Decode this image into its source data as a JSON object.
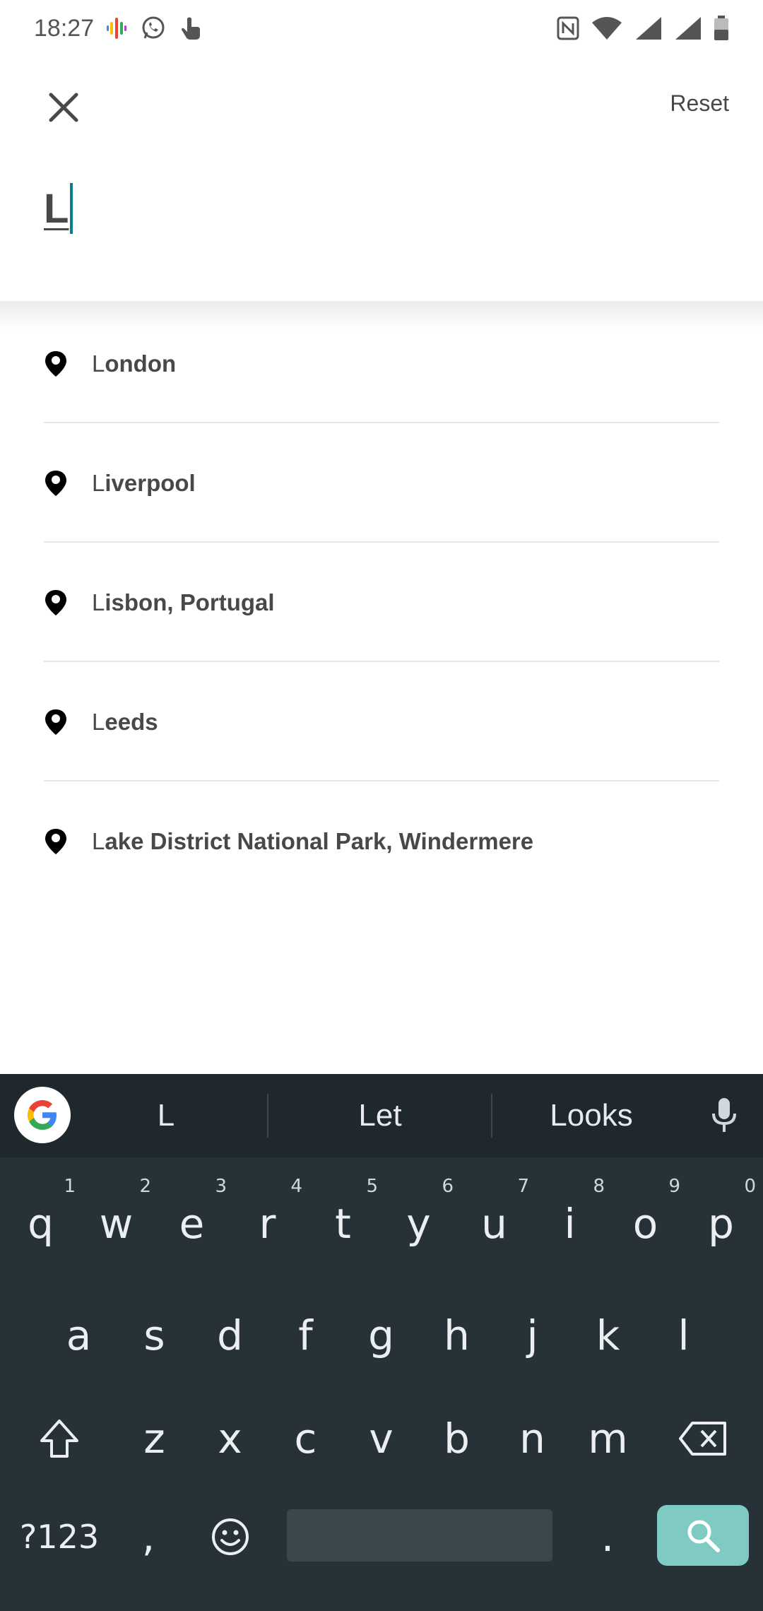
{
  "status_bar": {
    "time": "18:27",
    "left_icons": [
      "podcast-icon",
      "whatsapp-icon",
      "touch-icon"
    ],
    "right_icons": [
      "nfc-icon",
      "wifi-icon",
      "signal-icon",
      "signal-icon",
      "battery-icon"
    ]
  },
  "header": {
    "close_icon": "close-icon",
    "reset_label": "Reset"
  },
  "search": {
    "value": "L"
  },
  "suggestions": [
    {
      "first": "L",
      "rest": "ondon"
    },
    {
      "first": "L",
      "rest": "iverpool"
    },
    {
      "first": "L",
      "rest": "isbon, Portugal"
    },
    {
      "first": "L",
      "rest": "eeds"
    },
    {
      "first": "L",
      "rest": "ake District National Park, Windermere"
    }
  ],
  "keyboard": {
    "word_suggestions": [
      "L",
      "Let",
      "Looks"
    ],
    "row1": [
      {
        "k": "q",
        "h": "1"
      },
      {
        "k": "w",
        "h": "2"
      },
      {
        "k": "e",
        "h": "3"
      },
      {
        "k": "r",
        "h": "4"
      },
      {
        "k": "t",
        "h": "5"
      },
      {
        "k": "y",
        "h": "6"
      },
      {
        "k": "u",
        "h": "7"
      },
      {
        "k": "i",
        "h": "8"
      },
      {
        "k": "o",
        "h": "9"
      },
      {
        "k": "p",
        "h": "0"
      }
    ],
    "row2": [
      "a",
      "s",
      "d",
      "f",
      "g",
      "h",
      "j",
      "k",
      "l"
    ],
    "row3": [
      "z",
      "x",
      "c",
      "v",
      "b",
      "n",
      "m"
    ],
    "symbols_key": "?123",
    "comma_key": ",",
    "period_key": ".",
    "colors": {
      "background": "#263238",
      "search_key": "#7fcac3"
    }
  }
}
